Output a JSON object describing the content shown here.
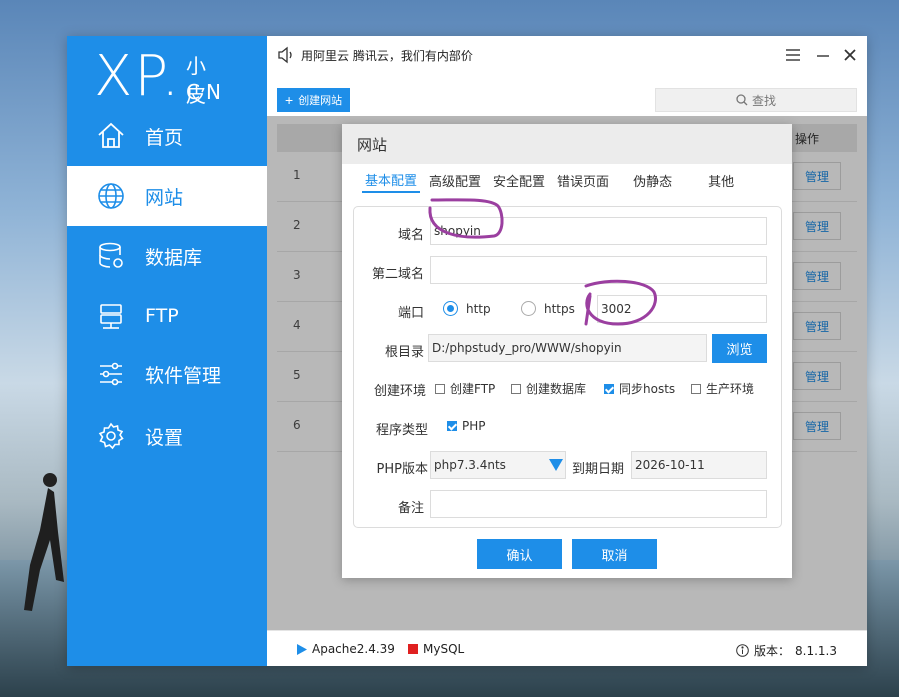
{
  "colors": {
    "accent": "#1e8ee8",
    "annotation": "#9b3fa0",
    "stop_red": "#e02020"
  },
  "sidebar": {
    "logo_main": "XP.",
    "logo_small": "小皮",
    "logo_cn": "CN",
    "items": [
      {
        "label": "首页",
        "icon": "home-icon"
      },
      {
        "label": "网站",
        "icon": "globe-icon",
        "active": true
      },
      {
        "label": "数据库",
        "icon": "database-icon"
      },
      {
        "label": "FTP",
        "icon": "server-icon"
      },
      {
        "label": "软件管理",
        "icon": "sliders-icon"
      },
      {
        "label": "设置",
        "icon": "gear-icon"
      }
    ]
  },
  "titlebar": {
    "notice": "用阿里云 腾讯云，我们有内部价"
  },
  "toolbar": {
    "create_label": "创建网站",
    "search_label": "查找"
  },
  "table": {
    "op_header": "操作",
    "rows": [
      {
        "num": "1",
        "action": "管理"
      },
      {
        "num": "2",
        "action": "管理"
      },
      {
        "num": "3",
        "action": "管理"
      },
      {
        "num": "4",
        "action": "管理"
      },
      {
        "num": "5",
        "action": "管理"
      },
      {
        "num": "6",
        "action": "管理"
      }
    ]
  },
  "status": {
    "apache": "Apache2.4.39",
    "mysql": "MySQL",
    "version_label": "版本：",
    "version": "8.1.1.3"
  },
  "modal": {
    "title": "网站",
    "tabs": [
      "基本配置",
      "高级配置",
      "安全配置",
      "错误页面",
      "伪静态",
      "其他"
    ],
    "fields": {
      "domain_label": "域名",
      "domain_value": "shopyin",
      "second_domain_label": "第二域名",
      "second_domain_value": "",
      "port_label": "端口",
      "port_http": "http",
      "port_https": "https",
      "port_value": "3002",
      "root_label": "根目录",
      "root_value": "D:/phpstudy_pro/WWW/shopyin",
      "browse_label": "浏览",
      "env_label": "创建环境",
      "env_options": [
        {
          "label": "创建FTP",
          "checked": false
        },
        {
          "label": "创建数据库",
          "checked": false
        },
        {
          "label": "同步hosts",
          "checked": true
        },
        {
          "label": "生产环境",
          "checked": false
        }
      ],
      "program_label": "程序类型",
      "program_value": "PHP",
      "php_version_label": "PHP版本",
      "php_version_value": "php7.3.4nts",
      "expire_label": "到期日期",
      "expire_value": "2026-10-11",
      "note_label": "备注",
      "note_value": ""
    },
    "confirm_label": "确认",
    "cancel_label": "取消"
  }
}
